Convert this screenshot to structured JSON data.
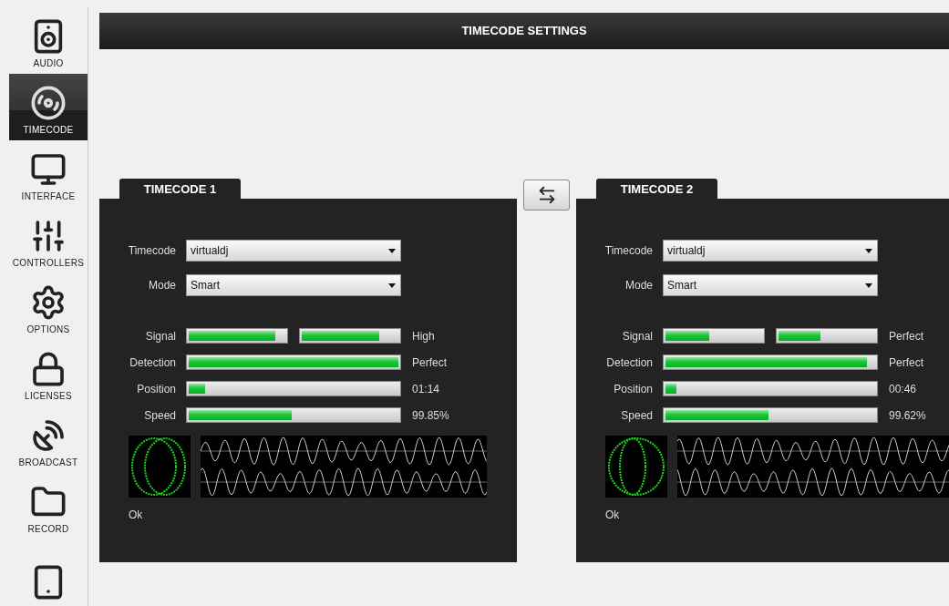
{
  "sidebar": {
    "items": [
      {
        "label": "AUDIO",
        "selected": false
      },
      {
        "label": "TIMECODE",
        "selected": true
      },
      {
        "label": "INTERFACE",
        "selected": false
      },
      {
        "label": "CONTROLLERS",
        "selected": false
      },
      {
        "label": "OPTIONS",
        "selected": false
      },
      {
        "label": "LICENSES",
        "selected": false
      },
      {
        "label": "BROADCAST",
        "selected": false
      },
      {
        "label": "RECORD",
        "selected": false
      },
      {
        "selected": false
      }
    ]
  },
  "header": {
    "title": "TIMECODE SETTINGS"
  },
  "panels": [
    {
      "tab": "TIMECODE 1",
      "fields": [
        {
          "label": "Timecode",
          "value": "virtualdj"
        },
        {
          "label": "Mode",
          "value": "Smart"
        }
      ],
      "meters": [
        {
          "label": "Signal",
          "bars": [
            {
              "level": 0.9
            },
            {
              "level": 0.8
            }
          ],
          "reading": "High"
        },
        {
          "label": "Detection",
          "bars": [
            {
              "level": 1
            }
          ],
          "reading": "Perfect"
        },
        {
          "label": "Position",
          "bars": [
            {
              "level": 0.08
            }
          ],
          "reading": "01:14"
        },
        {
          "label": "Speed",
          "bars": [
            {
              "level": 0.49
            }
          ],
          "reading": "99.85%"
        }
      ],
      "status": "Ok"
    },
    {
      "tab": "TIMECODE 2",
      "fields": [
        {
          "label": "Timecode",
          "value": "virtualdj"
        },
        {
          "label": "Mode",
          "value": "Smart"
        }
      ],
      "meters": [
        {
          "label": "Signal",
          "bars": [
            {
              "level": 0.45
            },
            {
              "level": 0.43
            }
          ],
          "reading": "Perfect"
        },
        {
          "label": "Detection",
          "bars": [
            {
              "level": 0.96
            }
          ],
          "reading": "Perfect"
        },
        {
          "label": "Position",
          "bars": [
            {
              "level": 0.05
            }
          ],
          "reading": "00:46"
        },
        {
          "label": "Speed",
          "bars": [
            {
              "level": 0.49
            }
          ],
          "reading": "99.62%"
        }
      ],
      "status": "Ok"
    }
  ]
}
